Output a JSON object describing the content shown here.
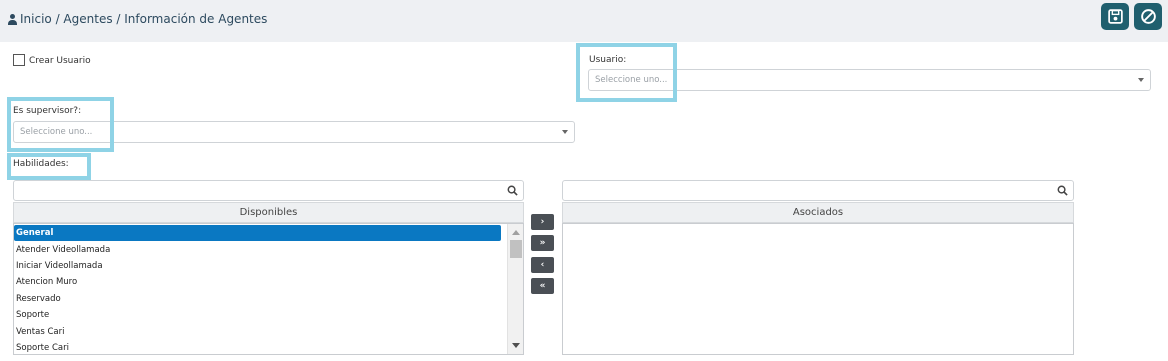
{
  "header": {
    "breadcrumb": "Inicio / Agentes / Información de Agentes",
    "save_icon": "save-icon",
    "cancel_icon": "cancel-icon",
    "button_color": "#1f5f6e"
  },
  "form": {
    "crear_usuario_label": "Crear Usuario",
    "crear_usuario_checked": false,
    "usuario_label": "Usuario:",
    "usuario_placeholder": "Seleccione uno...",
    "supervisor_label": "Es supervisor?:",
    "supervisor_placeholder": "Seleccione uno...",
    "habilidades_label": "Habilidades:"
  },
  "dual_list": {
    "available_header": "Disponibles",
    "associated_header": "Asociados",
    "available_items": [
      "General",
      "Atender Videollamada",
      "Iniciar Videollamada",
      "Atencion Muro",
      "Reservado",
      "Soporte",
      "Ventas Cari",
      "Soporte Cari"
    ],
    "selected_item": "General",
    "associated_items": [],
    "buttons": {
      "move_selected": "›",
      "move_all": "»",
      "remove_selected": "‹",
      "remove_all": "«"
    }
  },
  "colors": {
    "highlight": "#8fd3e6",
    "selection": "#0a78c2",
    "header_bg": "#eef0f3"
  }
}
